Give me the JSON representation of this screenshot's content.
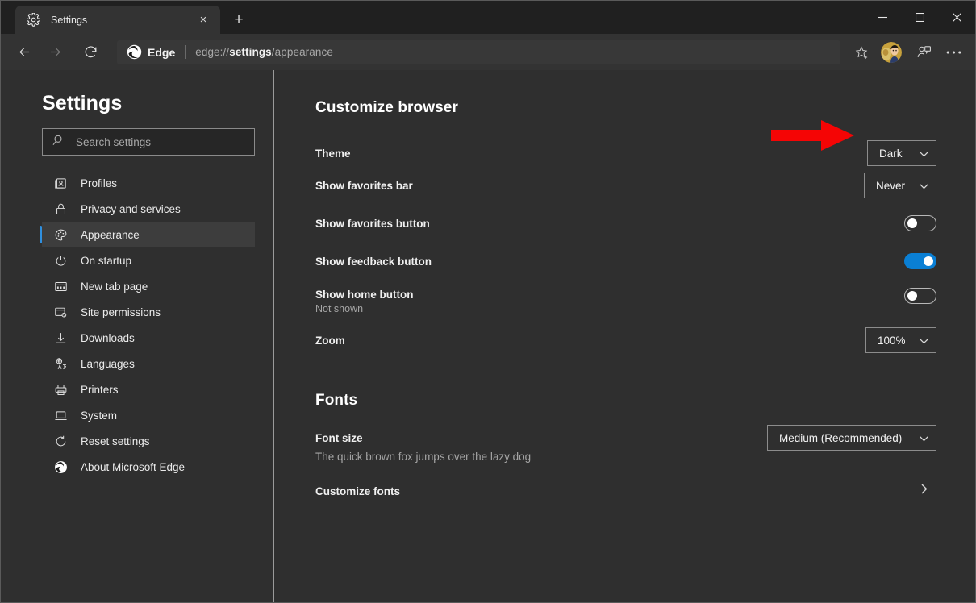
{
  "window": {
    "minimize_label": "Minimize",
    "maximize_label": "Maximize",
    "close_label": "Close"
  },
  "tab": {
    "title": "Settings",
    "icon": "gear-icon",
    "close_label": "×",
    "new_tab_label": "+"
  },
  "toolbar": {
    "back_label": "Back",
    "forward_label": "Forward",
    "refresh_label": "Refresh",
    "brand": "Edge",
    "url_prefix": "edge://",
    "url_bold": "settings",
    "url_suffix": "/appearance",
    "favorites_label": "Add this page to favorites",
    "collections_label": "Collections",
    "more_label": "Settings and more"
  },
  "sidebar": {
    "title": "Settings",
    "search": {
      "placeholder": "Search settings",
      "value": ""
    },
    "items": [
      {
        "label": "Profiles",
        "icon": "profile-card-icon",
        "active": false
      },
      {
        "label": "Privacy and services",
        "icon": "lock-icon",
        "active": false
      },
      {
        "label": "Appearance",
        "icon": "palette-icon",
        "active": true
      },
      {
        "label": "On startup",
        "icon": "power-icon",
        "active": false
      },
      {
        "label": "New tab page",
        "icon": "new-tab-page-icon",
        "active": false
      },
      {
        "label": "Site permissions",
        "icon": "site-permissions-icon",
        "active": false
      },
      {
        "label": "Downloads",
        "icon": "download-arrow-icon",
        "active": false
      },
      {
        "label": "Languages",
        "icon": "languages-icon",
        "active": false
      },
      {
        "label": "Printers",
        "icon": "printer-icon",
        "active": false
      },
      {
        "label": "System",
        "icon": "laptop-icon",
        "active": false
      },
      {
        "label": "Reset settings",
        "icon": "reset-circular-arrow-icon",
        "active": false
      },
      {
        "label": "About Microsoft Edge",
        "icon": "edge-logo-icon",
        "active": false
      }
    ]
  },
  "main": {
    "customize_heading": "Customize browser",
    "fonts_heading": "Fonts",
    "theme": {
      "label": "Theme",
      "value": "Dark"
    },
    "favorites_bar": {
      "label": "Show favorites bar",
      "value": "Never"
    },
    "favorites_button": {
      "label": "Show favorites button",
      "state": "off"
    },
    "feedback_button": {
      "label": "Show feedback button",
      "state": "on"
    },
    "home_button": {
      "label": "Show home button",
      "sub": "Not shown",
      "state": "off"
    },
    "zoom": {
      "label": "Zoom",
      "value": "100%"
    },
    "font_size": {
      "label": "Font size",
      "value": "Medium (Recommended)",
      "preview": "The quick brown fox jumps over the lazy dog"
    },
    "customize_fonts": {
      "label": "Customize fonts",
      "chevron": "›"
    }
  },
  "annotation": {
    "type": "red-arrow",
    "points_to": "theme-dropdown",
    "color": "#f50505"
  },
  "colors": {
    "window_bg": "#2f2f2f",
    "titlebar_bg": "#202020",
    "toolbar_bg": "#333333",
    "accent": "#2f8fde",
    "toggle_on": "#0a7fd4",
    "text_primary": "#f0f0f0",
    "text_secondary": "#a5a5a5"
  }
}
